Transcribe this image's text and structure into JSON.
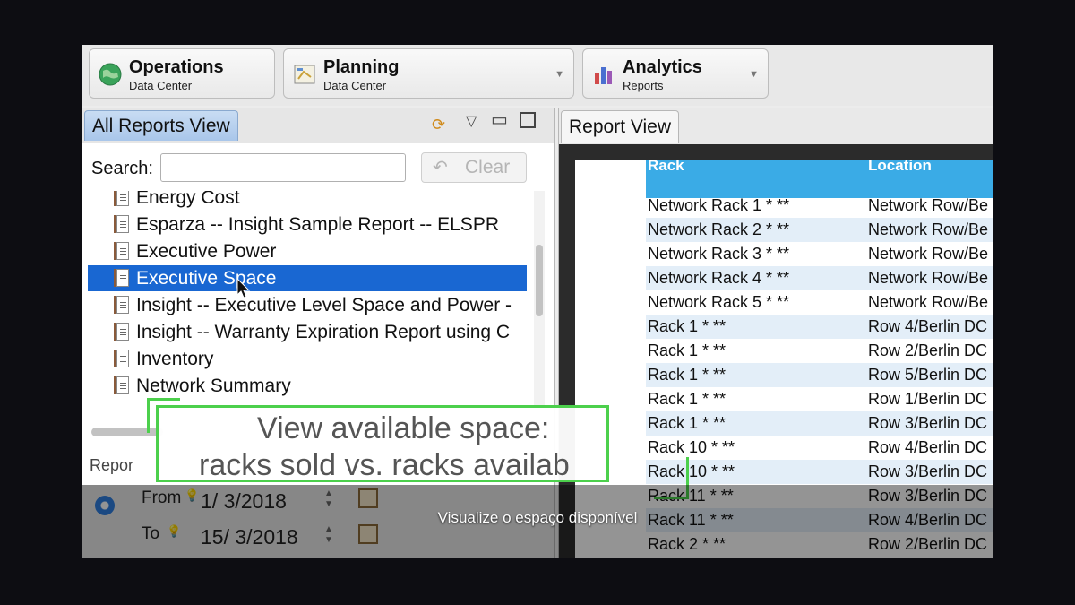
{
  "perspectives": [
    {
      "title": "Operations",
      "subtitle": "Data Center",
      "icon": "globe-icon",
      "dropdown": false
    },
    {
      "title": "Planning",
      "subtitle": "Data Center",
      "icon": "planning-icon",
      "dropdown": true
    },
    {
      "title": "Analytics",
      "subtitle": "Reports",
      "icon": "bar-chart-icon",
      "dropdown": true
    }
  ],
  "left_panel": {
    "tab": "All Reports View",
    "search_label": "Search:",
    "search_value": "",
    "clear_label": "Clear",
    "items": [
      {
        "label": "Energy Cost",
        "selected": false
      },
      {
        "label": "Esparza -- Insight Sample Report -- ELSPR",
        "selected": false
      },
      {
        "label": "Executive Power",
        "selected": false
      },
      {
        "label": "Executive Space",
        "selected": true
      },
      {
        "label": "Insight -- Executive Level Space and Power -",
        "selected": false
      },
      {
        "label": "Insight -- Warranty Expiration Report using C",
        "selected": false
      },
      {
        "label": "Inventory",
        "selected": false
      },
      {
        "label": "Network Summary",
        "selected": false
      }
    ],
    "params_header": "Repor",
    "from_label": "From",
    "from_value": "1/ 3/2018",
    "to_label": "To",
    "to_value": "15/ 3/2018"
  },
  "right_panel": {
    "tab": "Report View",
    "columns": [
      "Rack",
      "Location"
    ],
    "rows": [
      [
        "Network Rack 1 * **",
        "Network Row/Be"
      ],
      [
        "Network Rack 2 * **",
        "Network Row/Be"
      ],
      [
        "Network Rack 3 * **",
        "Network Row/Be"
      ],
      [
        "Network Rack 4 * **",
        "Network Row/Be"
      ],
      [
        "Network Rack 5 * **",
        "Network Row/Be"
      ],
      [
        "Rack 1 * **",
        "Row 4/Berlin DC"
      ],
      [
        "Rack 1 * **",
        "Row 2/Berlin DC"
      ],
      [
        "Rack 1 * **",
        "Row 5/Berlin DC"
      ],
      [
        "Rack 1 * **",
        "Row 1/Berlin DC"
      ],
      [
        "Rack 1 * **",
        "Row 3/Berlin DC"
      ],
      [
        "Rack 10 * **",
        "Row 4/Berlin DC"
      ],
      [
        "Rack 10 * **",
        "Row 3/Berlin DC"
      ],
      [
        "Rack 11 * **",
        "Row 3/Berlin DC"
      ],
      [
        "Rack 11 * **",
        "Row 4/Berlin DC"
      ],
      [
        "Rack 2 * **",
        "Row 2/Berlin DC"
      ]
    ]
  },
  "callout": {
    "line1": "View available space:",
    "line2": "racks sold vs. racks availab"
  },
  "subtitle": "Visualize o espaço disponível",
  "colors": {
    "accent": "#4cd04c",
    "selection": "#1967d2",
    "table_header": "#3aabe6"
  }
}
